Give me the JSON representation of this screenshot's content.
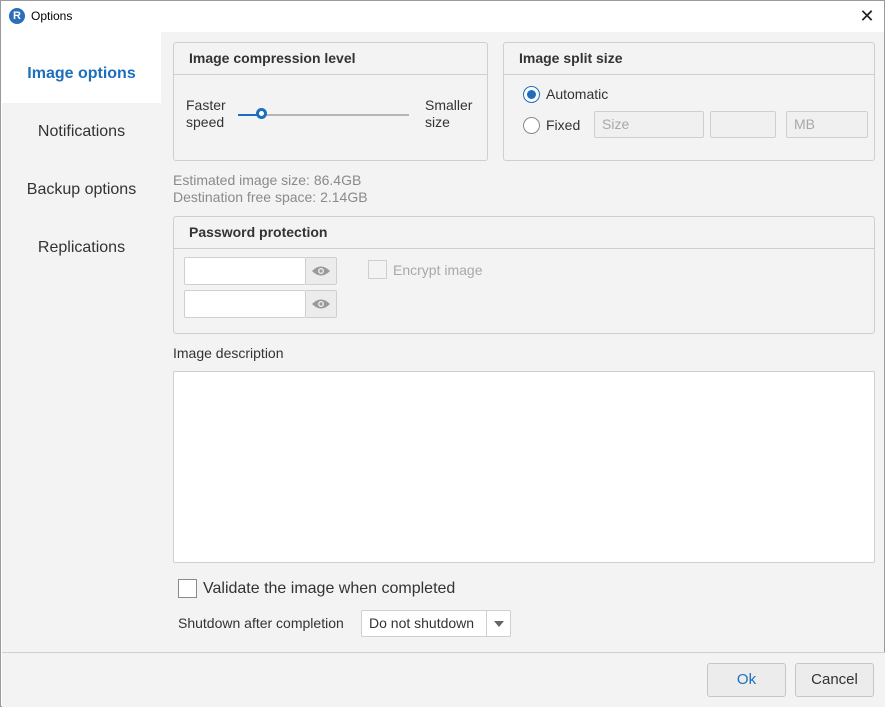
{
  "window": {
    "title": "Options",
    "app_icon_letter": "R",
    "close_icon": "close-icon"
  },
  "sidebar": {
    "items": [
      {
        "label": "Image options",
        "active": true
      },
      {
        "label": "Notifications",
        "active": false
      },
      {
        "label": "Backup options",
        "active": false
      },
      {
        "label": "Replications",
        "active": false
      }
    ]
  },
  "compression": {
    "title": "Image compression level",
    "left_label_line1": "Faster",
    "left_label_line2": "speed",
    "right_label_line1": "Smaller",
    "right_label_line2": "size",
    "slider_level": 0.15
  },
  "split": {
    "title": "Image split size",
    "automatic_label": "Automatic",
    "fixed_label": "Fixed",
    "selected": "automatic",
    "size_placeholder": "Size",
    "number_value": "",
    "unit_placeholder": "MB"
  },
  "info": {
    "estimated_size": "Estimated image size: 86.4GB",
    "free_space": "Destination free space: 2.14GB"
  },
  "password": {
    "title": "Password protection",
    "field1_value": "",
    "field2_value": "",
    "encrypt_label": "Encrypt image",
    "encrypt_checked": false
  },
  "description": {
    "label": "Image description",
    "value": ""
  },
  "validate": {
    "label": "Validate the image when completed",
    "checked": false
  },
  "shutdown": {
    "label": "Shutdown after completion",
    "selected": "Do not shutdown"
  },
  "footer": {
    "ok_label": "Ok",
    "cancel_label": "Cancel"
  },
  "colors": {
    "accent": "#1d6fbe",
    "panel": "#f3f3f3"
  }
}
